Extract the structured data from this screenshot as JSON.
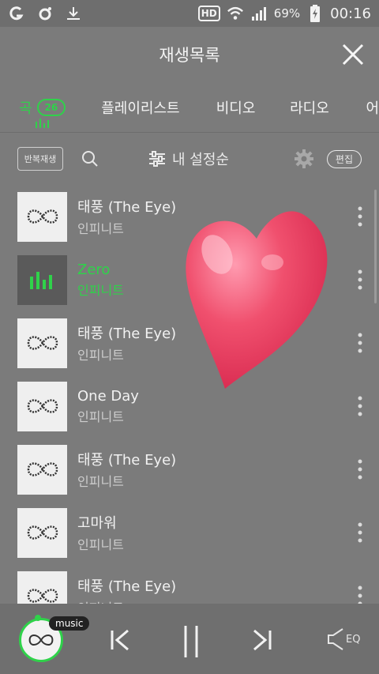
{
  "status_bar": {
    "battery": "69%",
    "time": "00:16",
    "hd_label": "HD"
  },
  "header": {
    "title": "재생목록"
  },
  "tabs": [
    {
      "label": "곡",
      "count": "26",
      "active": true
    },
    {
      "label": "플레이리스트"
    },
    {
      "label": "비디오"
    },
    {
      "label": "라디오"
    },
    {
      "label": "어"
    }
  ],
  "toolbar": {
    "repeat_label": "반복재생",
    "sort_label": "내 설정순",
    "edit_label": "편집"
  },
  "songs": [
    {
      "title": "태풍 (The Eye)",
      "artist": "인피니트"
    },
    {
      "title": "Zero",
      "artist": "인피니트",
      "playing": true
    },
    {
      "title": "태풍 (The Eye)",
      "artist": "인피니트"
    },
    {
      "title": "One Day",
      "artist": "인피니트"
    },
    {
      "title": "태풍 (The Eye)",
      "artist": "인피니트"
    },
    {
      "title": "고마워",
      "artist": "인피니트"
    },
    {
      "title": "태풍 (The Eye)",
      "artist": "인피니트"
    }
  ],
  "player": {
    "tag": "music",
    "eq_label": "EQ"
  },
  "colors": {
    "accent": "#2fd24a",
    "background": "#7b7b7b",
    "heart": "#f0506e"
  },
  "icons": {
    "close": "close-icon",
    "search": "search-icon",
    "sort": "sliders-icon",
    "gear": "gear-icon",
    "more": "more-vertical-icon",
    "prev": "previous-icon",
    "pause": "pause-icon",
    "next": "next-icon",
    "eq": "equalizer-icon",
    "heart": "heart-icon"
  }
}
